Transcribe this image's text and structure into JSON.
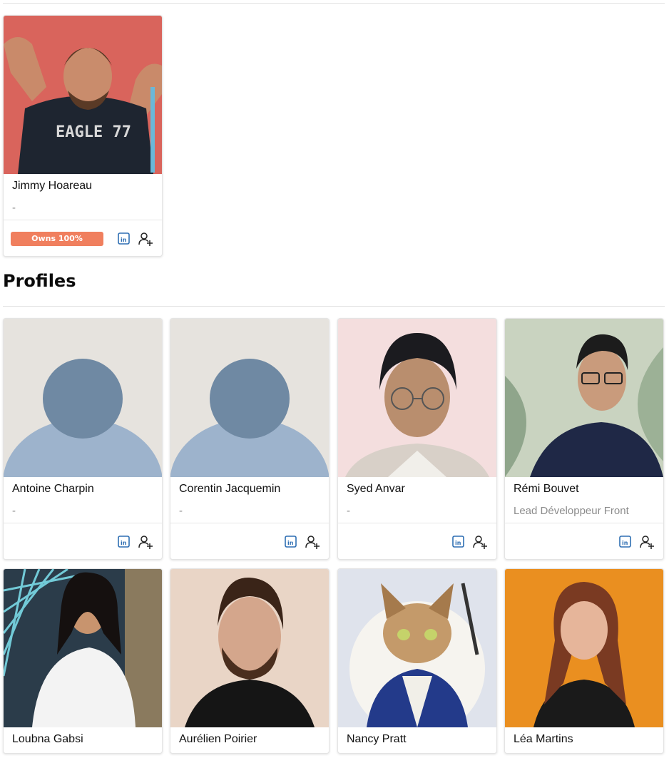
{
  "featured": {
    "name": "Jimmy Hoareau",
    "role": "-",
    "badge": "Owns 100%",
    "shirt_text": "EAGLE 77"
  },
  "profiles": {
    "title": "Profiles",
    "cards": [
      {
        "name": "Antoine Charpin",
        "role": "-"
      },
      {
        "name": "Corentin Jacquemin",
        "role": "-"
      },
      {
        "name": "Syed Anvar",
        "role": "-"
      },
      {
        "name": "Rémi Bouvet",
        "role": "Lead Développeur Front"
      },
      {
        "name": "Loubna Gabsi",
        "role": ""
      },
      {
        "name": "Aurélien Poirier",
        "role": ""
      },
      {
        "name": "Nancy Pratt",
        "role": ""
      },
      {
        "name": "Léa Martins",
        "role": ""
      }
    ]
  },
  "icons": {
    "linkedin": "linkedin-icon",
    "add_contact": "add-user-icon",
    "avatar_placeholder": "avatar-placeholder-icon"
  },
  "colors": {
    "badge": "#f07f5e",
    "linkedin": "#2f6fb3",
    "placeholder_bg": "#e6e3de",
    "placeholder_head": "#6f89a3",
    "placeholder_body": "#9db3cc"
  }
}
